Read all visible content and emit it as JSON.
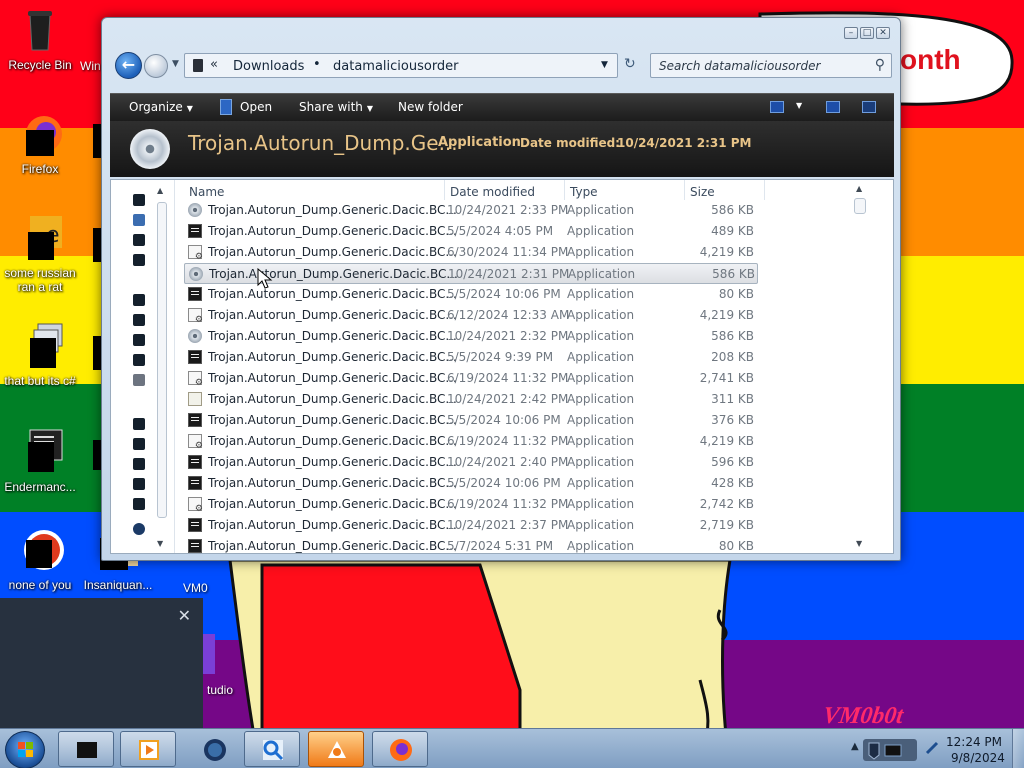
{
  "desktop": {
    "icons": [
      {
        "label": "Recycle Bin"
      },
      {
        "label": "Firefox"
      },
      {
        "label": "some russian\nran a rat"
      },
      {
        "label": "that but its c#"
      },
      {
        "label": "Endermanc..."
      },
      {
        "label": "none of you"
      },
      {
        "label": "Insaniquan..."
      }
    ],
    "partial_labels": [
      "Win",
      "VM0",
      "tudio"
    ],
    "wallpaper_text": "onth",
    "wallpaper_signature": "VM0b0t"
  },
  "explorer": {
    "address": {
      "crumbs": [
        "Downloads",
        "datamaliciousorder"
      ],
      "chevrons": "«"
    },
    "search": {
      "placeholder": "Search datamaliciousorder"
    },
    "commands": {
      "organize": "Organize",
      "open": "Open",
      "share_with": "Share with",
      "new_folder": "New folder"
    },
    "details": {
      "name": "Trojan.Autorun_Dump.Ge...",
      "type": "Application",
      "date_label": "Date modified:",
      "date_value": "10/24/2021 2:31 PM"
    },
    "columns": {
      "name": "Name",
      "date": "Date modified",
      "type": "Type",
      "size": "Size"
    },
    "files": [
      {
        "name": "Trojan.Autorun_Dump.Generic.Dacic.BC...",
        "date": "10/24/2021 2:33 PM",
        "type": "Application",
        "size": "586 KB",
        "icon": "disc"
      },
      {
        "name": "Trojan.Autorun_Dump.Generic.Dacic.BC...",
        "date": "5/5/2024 4:05 PM",
        "type": "Application",
        "size": "489 KB",
        "icon": "exe"
      },
      {
        "name": "Trojan.Autorun_Dump.Generic.Dacic.BC...",
        "date": "6/30/2024 11:34 PM",
        "type": "Application",
        "size": "4,219 KB",
        "icon": "setup"
      },
      {
        "name": "Trojan.Autorun_Dump.Generic.Dacic.BC...",
        "date": "10/24/2021 2:31 PM",
        "type": "Application",
        "size": "586 KB",
        "icon": "disc"
      },
      {
        "name": "Trojan.Autorun_Dump.Generic.Dacic.BC...",
        "date": "5/5/2024 10:06 PM",
        "type": "Application",
        "size": "80 KB",
        "icon": "exe"
      },
      {
        "name": "Trojan.Autorun_Dump.Generic.Dacic.BC...",
        "date": "6/12/2024 12:33 AM",
        "type": "Application",
        "size": "4,219 KB",
        "icon": "setup"
      },
      {
        "name": "Trojan.Autorun_Dump.Generic.Dacic.BC...",
        "date": "10/24/2021 2:32 PM",
        "type": "Application",
        "size": "586 KB",
        "icon": "disc"
      },
      {
        "name": "Trojan.Autorun_Dump.Generic.Dacic.BC...",
        "date": "5/5/2024 9:39 PM",
        "type": "Application",
        "size": "208 KB",
        "icon": "exe"
      },
      {
        "name": "Trojan.Autorun_Dump.Generic.Dacic.BC...",
        "date": "6/19/2024 11:32 PM",
        "type": "Application",
        "size": "2,741 KB",
        "icon": "setup"
      },
      {
        "name": "Trojan.Autorun_Dump.Generic.Dacic.BC...",
        "date": "10/24/2021 2:42 PM",
        "type": "Application",
        "size": "311 KB",
        "icon": "doc"
      },
      {
        "name": "Trojan.Autorun_Dump.Generic.Dacic.BC...",
        "date": "5/5/2024 10:06 PM",
        "type": "Application",
        "size": "376 KB",
        "icon": "exe"
      },
      {
        "name": "Trojan.Autorun_Dump.Generic.Dacic.BC...",
        "date": "6/19/2024 11:32 PM",
        "type": "Application",
        "size": "4,219 KB",
        "icon": "setup"
      },
      {
        "name": "Trojan.Autorun_Dump.Generic.Dacic.BC...",
        "date": "10/24/2021 2:40 PM",
        "type": "Application",
        "size": "596 KB",
        "icon": "exe"
      },
      {
        "name": "Trojan.Autorun_Dump.Generic.Dacic.BC...",
        "date": "5/5/2024 10:06 PM",
        "type": "Application",
        "size": "428 KB",
        "icon": "exe"
      },
      {
        "name": "Trojan.Autorun_Dump.Generic.Dacic.BC...",
        "date": "6/19/2024 11:32 PM",
        "type": "Application",
        "size": "2,742 KB",
        "icon": "setup"
      },
      {
        "name": "Trojan.Autorun_Dump.Generic.Dacic.BC...",
        "date": "10/24/2021 2:37 PM",
        "type": "Application",
        "size": "2,719 KB",
        "icon": "exe"
      },
      {
        "name": "Trojan.Autorun_Dump.Generic.Dacic.BC...",
        "date": "5/7/2024 5:31 PM",
        "type": "Application",
        "size": "80 KB",
        "icon": "exe"
      }
    ],
    "selected_index": 3
  },
  "taskbar": {
    "clock_time": "12:24 PM",
    "clock_date": "9/8/2024"
  },
  "colors": {
    "details_text": "#e8c488",
    "rainbow": [
      "#ff0018",
      "#ff8c00",
      "#ffed00",
      "#008026",
      "#004dff",
      "#750787"
    ]
  }
}
